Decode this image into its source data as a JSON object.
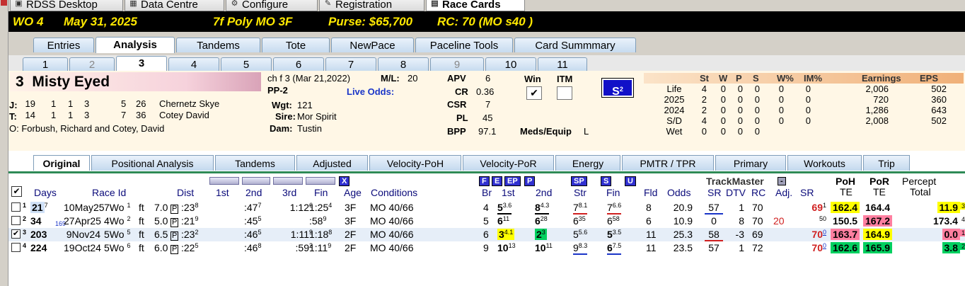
{
  "app_tabs": [
    {
      "icon": "desktop-icon",
      "label": "RDSS Desktop"
    },
    {
      "icon": "data-centre-icon",
      "label": "Data Centre"
    },
    {
      "icon": "configure-icon",
      "label": "Configure"
    },
    {
      "icon": "registration-icon",
      "label": "Registration"
    },
    {
      "icon": "race-cards-icon",
      "label": "Race Cards"
    }
  ],
  "race_header": {
    "race": "WO 4",
    "date": "May 31, 2025",
    "conditions": "7f Poly MO 3F",
    "purse": "Purse: $65,700",
    "rc": "RC: 70 (MO s40 )"
  },
  "main_tabs": [
    "Entries",
    "Analysis",
    "Tandems",
    "Tote",
    "NewPace",
    "Paceline Tools",
    "Card Summmary"
  ],
  "main_tab_active": "Analysis",
  "horse_tabs": [
    "1",
    "2",
    "3",
    "4",
    "5",
    "6",
    "7",
    "8",
    "9",
    "10",
    "11"
  ],
  "horse_tab_active": "3",
  "horse": {
    "number": "3",
    "name": "Misty Eyed",
    "jockey_label": "J:",
    "jockey_stats": [
      "19",
      "1",
      "1",
      "3",
      "5",
      "26"
    ],
    "jockey_name": "Chernetz Skye",
    "trainer_label": "T:",
    "trainer_stats": [
      "14",
      "1",
      "1",
      "3",
      "7",
      "36"
    ],
    "trainer_name": "Cotey David",
    "owner": "O: Forbush, Richard and Cotey, David",
    "desc": "ch f 3 (Mar 21,2022)",
    "ml_label": "M/L:",
    "ml": "20",
    "pp": "PP-2",
    "live_odds_label": "Live Odds:",
    "wgt_label": "Wgt:",
    "wgt": "121",
    "sire_label": "Sire:",
    "sire": "Mor Spirit",
    "dam_label": "Dam:",
    "dam": "Tustin",
    "metrics": [
      {
        "label": "APV",
        "value": "6"
      },
      {
        "label": "CR",
        "value": "0.36"
      },
      {
        "label": "CSR",
        "value": "7"
      },
      {
        "label": "PL",
        "value": "45"
      },
      {
        "label": "BPP",
        "value": "97.1"
      }
    ],
    "win_label": "Win",
    "itm_label": "ITM",
    "win_checked": "✔",
    "meds_label": "Meds/Equip",
    "meds": "L",
    "s2_label": "S",
    "s2_sup": "2"
  },
  "stat_table": {
    "headers": [
      "St",
      "W",
      "P",
      "S",
      "W%",
      "IM%",
      "Earnings",
      "EPS"
    ],
    "rows": [
      {
        "label": "Life",
        "vals": [
          "4",
          "0",
          "0",
          "0",
          "0",
          "0",
          "2,006",
          "502"
        ]
      },
      {
        "label": "2025",
        "vals": [
          "2",
          "0",
          "0",
          "0",
          "0",
          "0",
          "720",
          "360"
        ]
      },
      {
        "label": "2024",
        "vals": [
          "2",
          "0",
          "0",
          "0",
          "0",
          "0",
          "1,286",
          "643"
        ]
      },
      {
        "label": "S/D",
        "vals": [
          "4",
          "0",
          "0",
          "0",
          "0",
          "0",
          "2,008",
          "502"
        ]
      },
      {
        "label": "Wet",
        "vals": [
          "0",
          "0",
          "0",
          "0",
          "",
          "",
          "",
          ""
        ]
      }
    ]
  },
  "analysis_tabs": [
    "Original",
    "Positional Analysis",
    "Tandems",
    "Adjusted",
    "Velocity-PoH",
    "Velocity-PoR",
    "Energy",
    "PMTR / TPR",
    "Primary",
    "Workouts",
    "Trip"
  ],
  "analysis_tab_active": "Original",
  "grid": {
    "col_buttons": [
      "X",
      "F",
      "E",
      "EP",
      "P",
      "SP",
      "S",
      "U"
    ],
    "trackmaster_label": "TrackMaster",
    "trackmaster_btn": "-",
    "headers": {
      "days": "Days",
      "race_id": "Race Id",
      "dist": "Dist",
      "c1": "1st",
      "c2": "2nd",
      "c3": "3rd",
      "fin": "Fin",
      "age": "Age",
      "cond": "Conditions",
      "br": "Br",
      "b1": "1st",
      "b2": "2nd",
      "str": "Str",
      "fin2": "Fin",
      "fld": "Fld",
      "odds": "Odds",
      "sr": "SR",
      "dtv": "DTV",
      "rc": "RC",
      "adj": "Adj.",
      "sr2": "SR",
      "poh_top": "PoH",
      "poh_bot": "TE",
      "por_top": "PoR",
      "por_bot": "TE",
      "per_top": "Percept",
      "per_bot": "Total"
    },
    "rows": [
      {
        "n": "1",
        "checked": "",
        "days": "21",
        "days_sup": "7",
        "extra": "",
        "date": "10May25",
        "trk": "7Wo",
        "trk_sup": "1",
        "ft": "ft",
        "dist": "7.0",
        "surf": "P",
        "c1": ":23",
        "c1s": "8",
        "c2": ":47",
        "c2s": "7",
        "c3": "1:12",
        "c3s": "6",
        "fin": "1:25",
        "fins": "4",
        "age": "3F",
        "cond": "MO 40/66",
        "br": "4",
        "b1": "5",
        "b1s": "3.6",
        "b2": "8",
        "b2s": "4.3",
        "str": "7",
        "strs": "8.1",
        "f2": "7",
        "f2s": "6.6",
        "fld": "8",
        "odds": "20.9",
        "sr": "57",
        "dtv": "1",
        "rc": "70",
        "adj": "",
        "sr2": "69",
        "sr2s": "1",
        "poh": "162.4",
        "por": "164.4",
        "per": "11.9",
        "pers": "3"
      },
      {
        "n": "2",
        "checked": "",
        "days": "34",
        "days_sup": "",
        "extra": "169",
        "date": "27Apr25",
        "trk": "4Wo",
        "trk_sup": "2",
        "ft": "ft",
        "dist": "5.0",
        "surf": "P",
        "c1": ":21",
        "c1s": "9",
        "c2": ":45",
        "c2s": "5",
        "c3": "",
        "c3s": "",
        "fin": ":58",
        "fins": "9",
        "age": "3F",
        "cond": "MO 40/66",
        "br": "5",
        "b1": "6",
        "b1s": "11",
        "b2": "6",
        "b2s": "28",
        "str": "6",
        "strs": "35",
        "f2": "6",
        "f2s": "58",
        "fld": "6",
        "odds": "10.9",
        "sr": "0",
        "dtv": "8",
        "rc": "70",
        "adj": "20",
        "sr2": "",
        "sr2s": "50",
        "poh": "150.5",
        "por": "167.2",
        "per": "173.4",
        "pers": "4"
      },
      {
        "n": "3",
        "checked": "✔",
        "days": "203",
        "days_sup": "",
        "extra": "",
        "date": "9Nov24",
        "trk": "5Wo",
        "trk_sup": "5",
        "ft": "ft",
        "dist": "6.5",
        "surf": "P",
        "c1": ":23",
        "c1s": "2",
        "c2": ":46",
        "c2s": "5",
        "c3": "1:11",
        "c3s": "9",
        "fin": "1:18",
        "fins": "8",
        "age": "2F",
        "cond": "MO 40/66",
        "br": "6",
        "b1": "3",
        "b1s": "4.1",
        "b2": "2",
        "b2s": "3",
        "str": "5",
        "strs": "5.6",
        "f2": "5",
        "f2s": "3.5",
        "fld": "11",
        "odds": "25.3",
        "sr": "58",
        "dtv": "-3",
        "rc": "69",
        "adj": "",
        "sr2": "70",
        "sr2s": "0",
        "poh": "163.7",
        "por": "164.9",
        "per": "0.0",
        "pers": "1"
      },
      {
        "n": "4",
        "checked": "",
        "days": "224",
        "days_sup": "",
        "extra": "",
        "date": "19Oct24",
        "trk": "5Wo",
        "trk_sup": "6",
        "ft": "ft",
        "dist": "6.0",
        "surf": "P",
        "c1": ":22",
        "c1s": "5",
        "c2": ":46",
        "c2s": "8",
        "c3": ":59",
        "c3s": "2",
        "fin": "1:11",
        "fins": "9",
        "age": "2F",
        "cond": "MO 40/66",
        "br": "9",
        "b1": "10",
        "b1s": "13",
        "b2": "10",
        "b2s": "11",
        "str": "9",
        "strs": "8.3",
        "f2": "6",
        "f2s": "7.5",
        "fld": "11",
        "odds": "23.5",
        "sr": "57",
        "dtv": "1",
        "rc": "72",
        "adj": "",
        "sr2": "70",
        "sr2s": "0",
        "poh": "162.6",
        "por": "165.9",
        "per": "3.8",
        "pers": "2"
      }
    ]
  },
  "colors": {
    "header_bg": "#000000",
    "header_text": "#ffe800",
    "accent_blue": "#1a35c8",
    "yellow": "#ffff00",
    "green": "#00d060",
    "pink": "#ff7fa0"
  }
}
